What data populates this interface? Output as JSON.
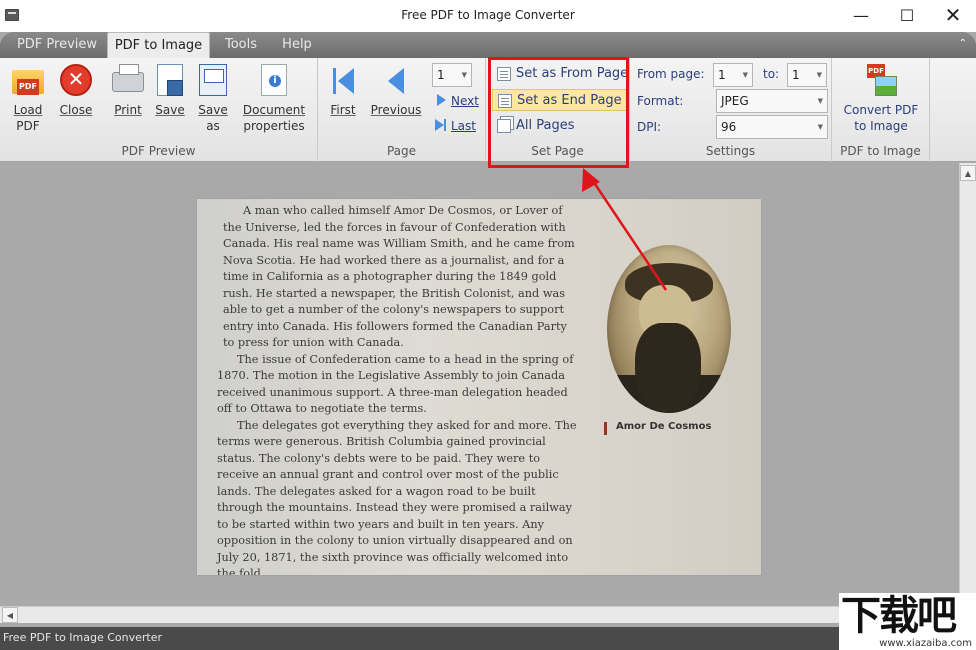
{
  "window": {
    "title": "Free PDF to Image Converter",
    "minimize": "—",
    "maximize": "☐",
    "close": "✕"
  },
  "tabs": [
    {
      "label": "PDF Preview"
    },
    {
      "label": "PDF to Image"
    },
    {
      "label": "Tools"
    },
    {
      "label": "Help"
    }
  ],
  "ribbon": {
    "pdf_preview": {
      "group_label": "PDF Preview",
      "load": "Load PDF",
      "load_line1": "Load",
      "load_line2": "PDF",
      "close": "Close",
      "print": "Print",
      "save": "Save",
      "save_as_line1": "Save",
      "save_as_line2": "as",
      "doc_props_line1": "Document",
      "doc_props_line2": "properties"
    },
    "page": {
      "group_label": "Page",
      "first": "First",
      "previous": "Previous",
      "page_number": "1",
      "next": "Next",
      "last": "Last"
    },
    "set_page": {
      "group_label": "Set Page",
      "set_from": "Set as From Page",
      "set_end": "Set as End Page",
      "all_pages": "All Pages"
    },
    "settings": {
      "group_label": "Settings",
      "from_page_label": "From page:",
      "from_page": "1",
      "to_label": "to:",
      "to_page": "1",
      "format_label": "Format:",
      "format": "JPEG",
      "dpi_label": "DPI:",
      "dpi": "96"
    },
    "convert": {
      "group_label": "PDF to Image",
      "line1": "Convert PDF",
      "line2": "to Image"
    }
  },
  "document": {
    "paragraphs": [
      "A man who called himself Amor De Cosmos, or Lover of the Universe, led the forces in favour of Confederation with Canada. His real name was William Smith, and he came from Nova Scotia. He had worked there as a journalist, and for a time in California as a photographer during the 1849 gold rush. He started a newspaper, the British Colonist, and was able to get a number of the colony's newspapers to support entry into Canada. His followers formed the Canadian Party to press for union with Canada.",
      "The issue of Confederation came to a head in the spring of 1870. The motion in the Legislative Assembly to join Canada received unanimous support. A three-man delegation headed off to Ottawa to negotiate the terms.",
      "The delegates got everything they asked for and more. The terms were generous. British Columbia gained provincial status. The colony's debts were to be paid. They were to receive an annual grant and control over most of the public lands. The delegates asked for a wagon road to be built through the mountains. Instead they were promised a railway to be started within two years and built in ten years. Any opposition in the colony to union virtually disappeared and on July 20, 1871, the sixth province was officially welcomed into the fold."
    ],
    "caption": "Amor De Cosmos"
  },
  "status": {
    "text": "Free PDF to Image Converter"
  },
  "watermark": {
    "big": "下载吧",
    "small": "www.xiazaiba.com"
  },
  "colors": {
    "highlight": "#e0141b",
    "link_text": "#2a3f7a",
    "hover_bg": "#fde7a3"
  }
}
